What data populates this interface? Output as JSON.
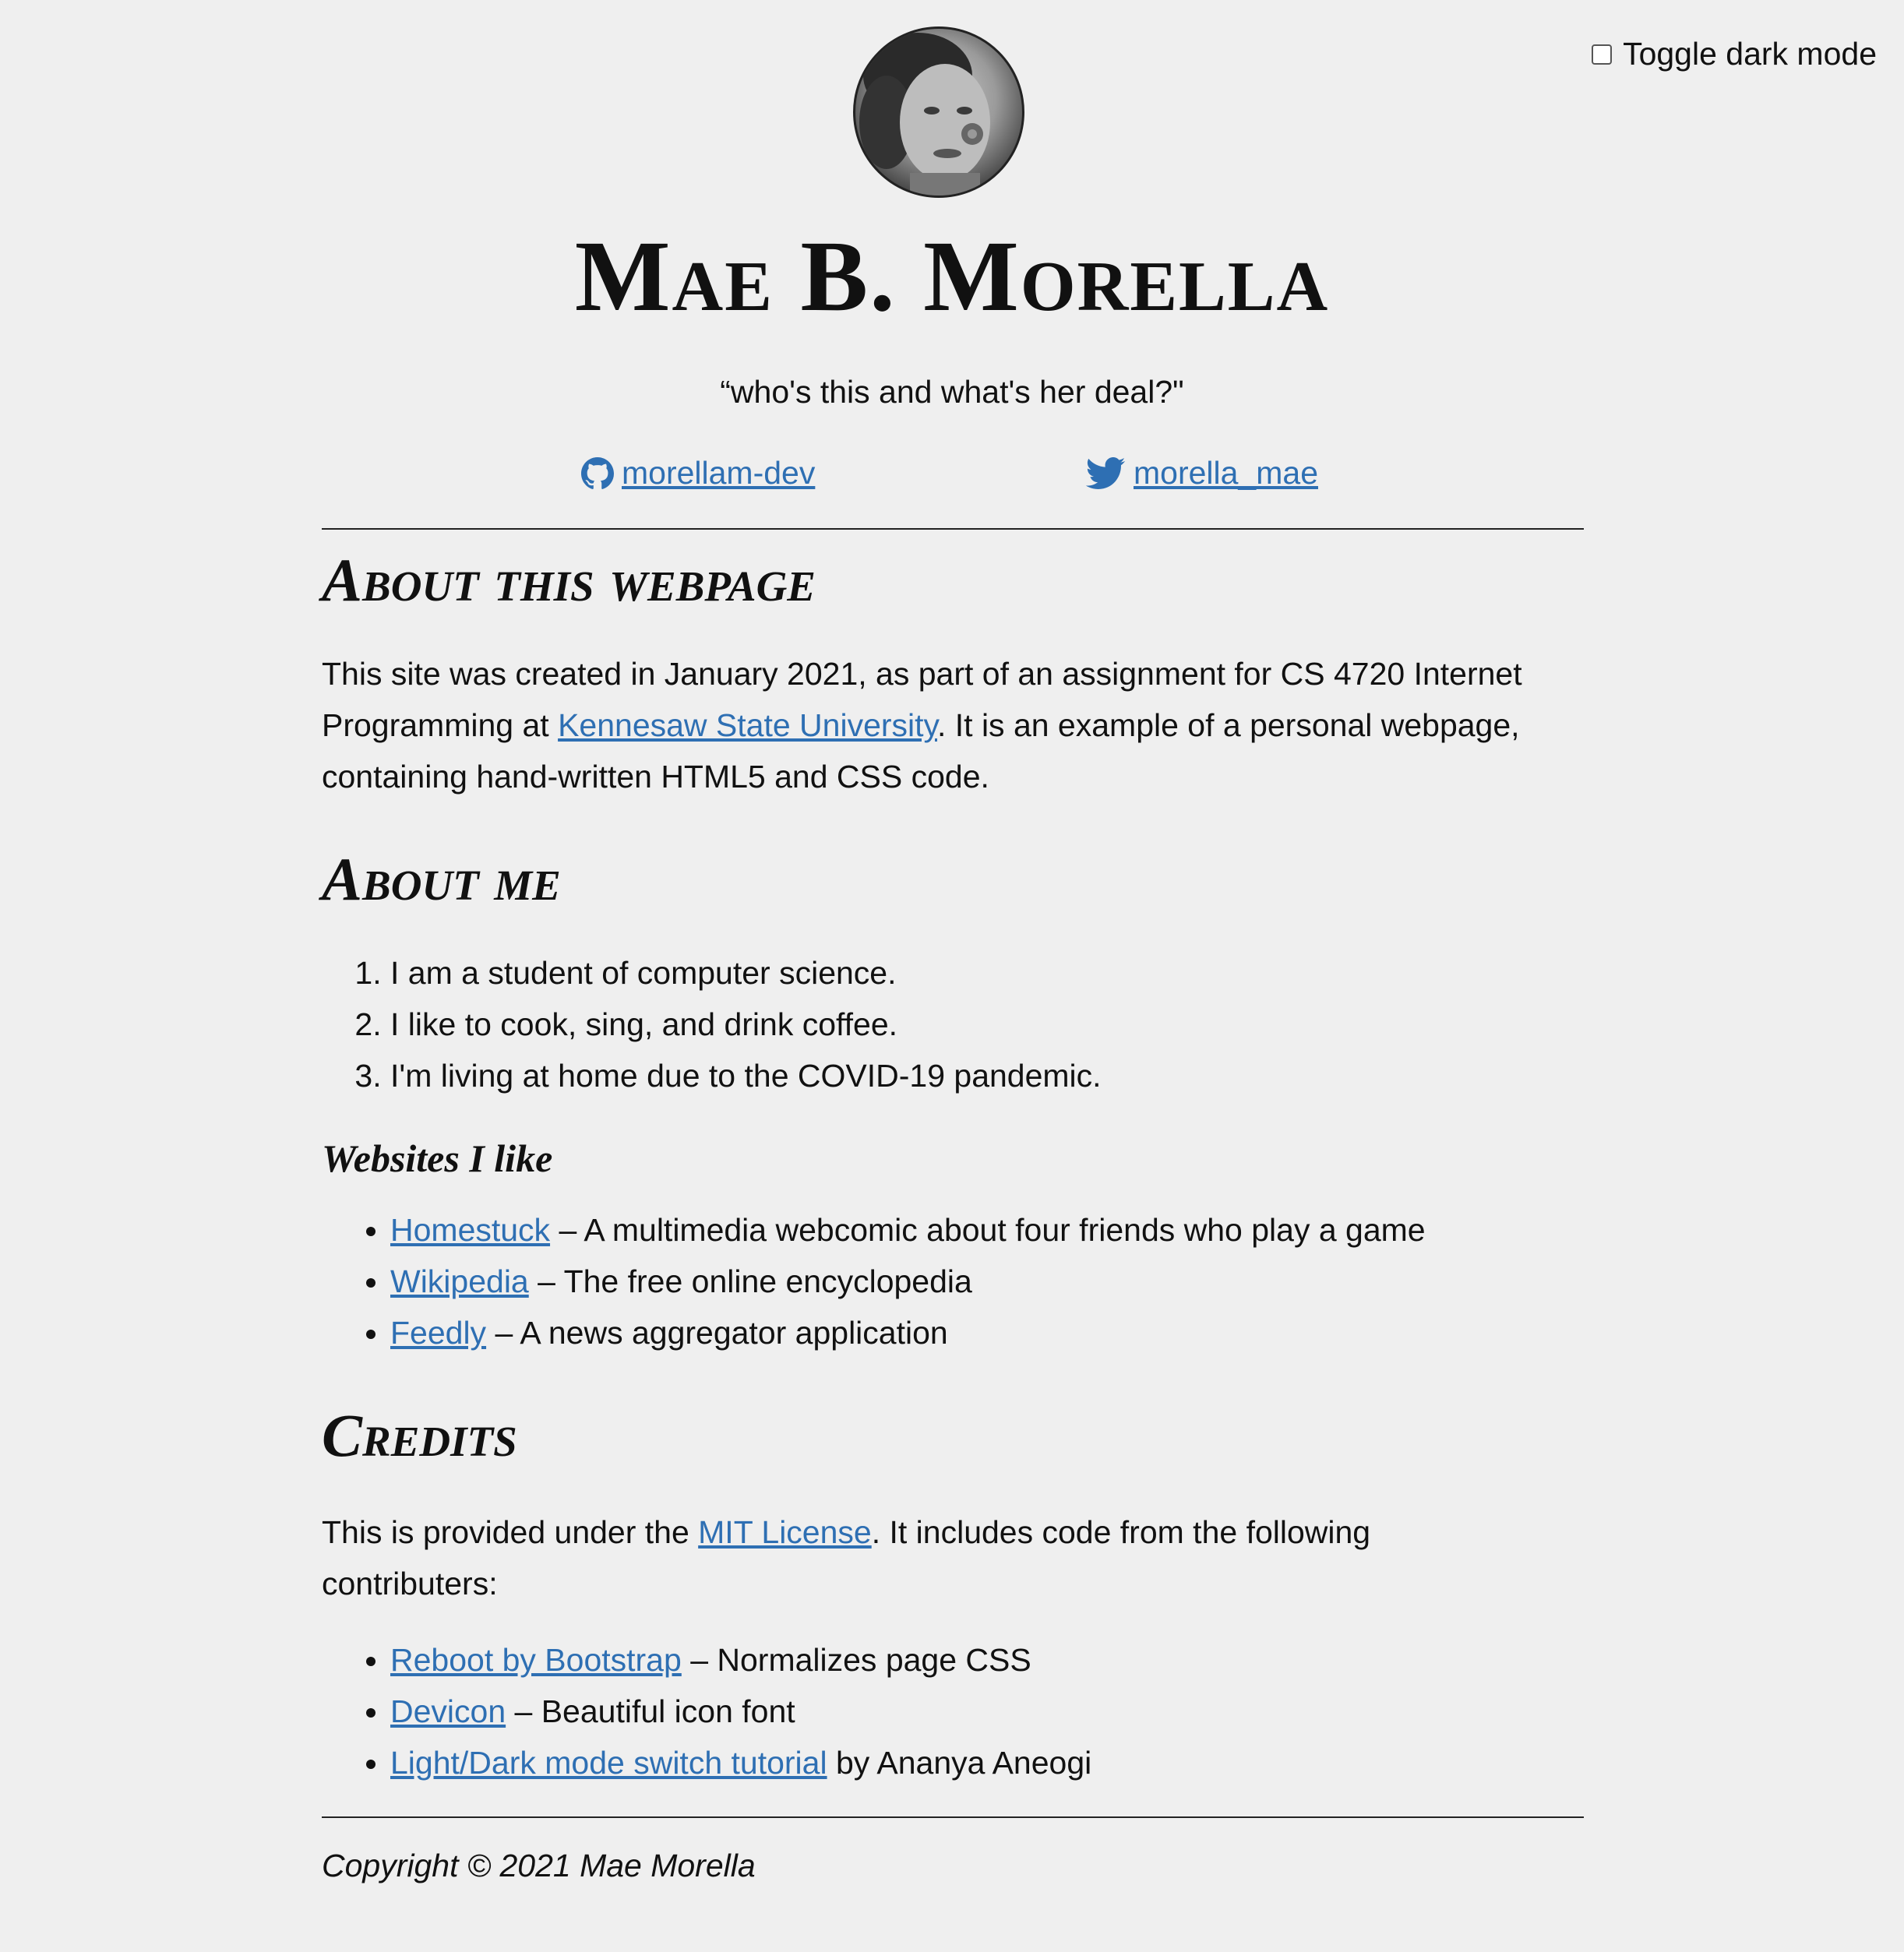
{
  "toggle": {
    "label": "Toggle dark mode",
    "checked": false
  },
  "header": {
    "name": "Mae B. Morella",
    "tagline": "“who's this and what's her deal?\"",
    "github": {
      "label": "morellam-dev",
      "icon": "github-icon"
    },
    "twitter": {
      "label": "morella_mae",
      "icon": "twitter-icon"
    }
  },
  "about_page": {
    "heading": "About this webpage",
    "text_before": "This site was created in January 2021, as part of an assignment for CS 4720 Internet Programming at ",
    "link": "Kennesaw State University",
    "text_after": ". It is an example of a personal webpage, containing hand-written HTML5 and CSS code."
  },
  "about_me": {
    "heading": "About me",
    "items": [
      "I am a student of computer science.",
      "I like to cook, sing, and drink coffee.",
      "I'm living at home due to the COVID-19 pandemic."
    ]
  },
  "websites": {
    "heading": "Websites I like",
    "items": [
      {
        "link": "Homestuck",
        "desc": " – A multimedia webcomic about four friends who play a game"
      },
      {
        "link": "Wikipedia",
        "desc": " – The free online encyclopedia"
      },
      {
        "link": "Feedly",
        "desc": " – A news aggregator application"
      }
    ]
  },
  "credits": {
    "heading": "Credits",
    "text_before": "This is provided under the ",
    "link": "MIT License",
    "text_after": ". It includes code from the following contributers:",
    "items": [
      {
        "link": "Reboot by Bootstrap",
        "desc": " – Normalizes page CSS"
      },
      {
        "link": "Devicon",
        "desc": " – Beautiful icon font"
      },
      {
        "link": "Light/Dark mode switch tutorial",
        "desc": " by Ananya Aneogi"
      }
    ]
  },
  "footer": {
    "copyright": "Copyright © 2021 Mae Morella"
  },
  "colors": {
    "background": "#efefef",
    "link": "#2e6fb3",
    "text": "#111111"
  }
}
